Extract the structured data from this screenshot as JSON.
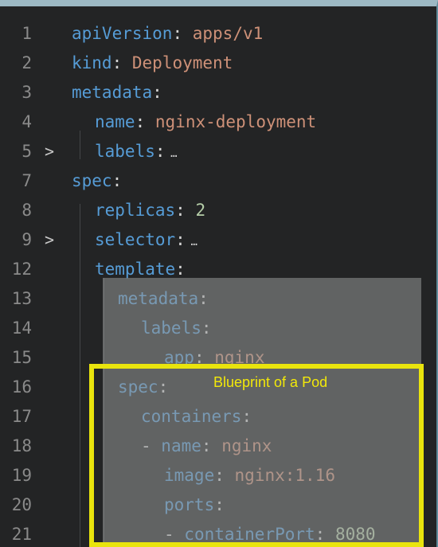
{
  "editor": {
    "lines": [
      {
        "num": "1",
        "indent": 0,
        "fold": "",
        "key": "apiVersion",
        "value": "apps/v1",
        "value_type": "val"
      },
      {
        "num": "2",
        "indent": 0,
        "fold": "",
        "key": "kind",
        "value": "Deployment",
        "value_type": "val"
      },
      {
        "num": "3",
        "indent": 0,
        "fold": "",
        "key": "metadata",
        "value": "",
        "value_type": ""
      },
      {
        "num": "4",
        "indent": 1,
        "fold": "",
        "key": "name",
        "value": "nginx-deployment",
        "value_type": "val"
      },
      {
        "num": "5",
        "indent": 1,
        "fold": ">",
        "key": "labels",
        "value": "…",
        "value_type": "ell"
      },
      {
        "num": "7",
        "indent": 0,
        "fold": "",
        "key": "spec",
        "value": "",
        "value_type": ""
      },
      {
        "num": "8",
        "indent": 1,
        "fold": "",
        "key": "replicas",
        "value": "2",
        "value_type": "num"
      },
      {
        "num": "9",
        "indent": 1,
        "fold": ">",
        "key": "selector",
        "value": "…",
        "value_type": "ell"
      },
      {
        "num": "12",
        "indent": 1,
        "fold": "",
        "key": "template",
        "value": "",
        "value_type": ""
      },
      {
        "num": "13",
        "indent": 2,
        "fold": "",
        "key": "metadata",
        "value": "",
        "value_type": ""
      },
      {
        "num": "14",
        "indent": 3,
        "fold": "",
        "key": "labels",
        "value": "",
        "value_type": ""
      },
      {
        "num": "15",
        "indent": 4,
        "fold": "",
        "key": "app",
        "value": "nginx",
        "value_type": "val"
      },
      {
        "num": "16",
        "indent": 2,
        "fold": "",
        "key": "spec",
        "value": "",
        "value_type": ""
      },
      {
        "num": "17",
        "indent": 3,
        "fold": "",
        "key": "containers",
        "value": "",
        "value_type": ""
      },
      {
        "num": "18",
        "indent": 3,
        "fold": "",
        "dash": true,
        "key": "name",
        "value": "nginx",
        "value_type": "val"
      },
      {
        "num": "19",
        "indent": 4,
        "fold": "",
        "key": "image",
        "value": "nginx:1.16",
        "value_type": "val"
      },
      {
        "num": "20",
        "indent": 4,
        "fold": "",
        "key": "ports",
        "value": "",
        "value_type": ""
      },
      {
        "num": "21",
        "indent": 4,
        "fold": "",
        "dash": true,
        "key": "containerPort",
        "value": "8080",
        "value_type": "num"
      }
    ]
  },
  "annotation": {
    "label": "Blueprint of a Pod",
    "color": "#e9e40d"
  }
}
